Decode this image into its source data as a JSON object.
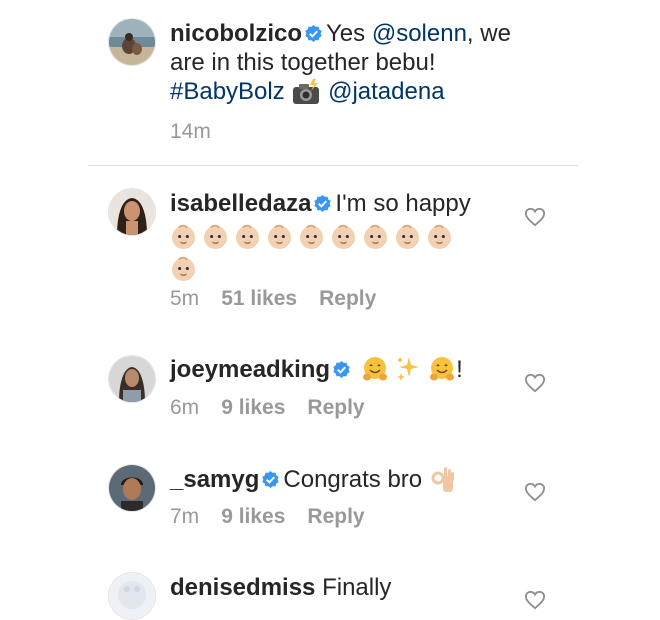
{
  "comments": [
    {
      "username": "nicobolzico",
      "verified": true,
      "text_before": "Yes ",
      "mention1": "@solenn",
      "text_mid": ", we are in this together bebu!",
      "hashtag": "#BabyBolz",
      "camera_emoji": "camera-with-flash",
      "mention2": "@jatadena",
      "time": "14m"
    },
    {
      "username": "isabelledaza",
      "verified": true,
      "text": "I'm so happy",
      "emoji": "baby-face",
      "emoji_count": 10,
      "time": "5m",
      "likes": "51 likes",
      "reply": "Reply"
    },
    {
      "username": "joeymeadking",
      "verified": true,
      "emoji": [
        "hugging-face",
        "sparkles",
        "hugging-face"
      ],
      "text_after": "!",
      "time": "6m",
      "likes": "9 likes",
      "reply": "Reply"
    },
    {
      "username": "_samyg",
      "verified": true,
      "text": "Congrats bro",
      "emoji": "ok-hand",
      "time": "7m",
      "likes": "9 likes",
      "reply": "Reply"
    },
    {
      "username": "denisedmiss",
      "verified": false,
      "text": "Finally"
    }
  ],
  "colors": {
    "text": "#262626",
    "muted": "#999999",
    "link": "#003569",
    "verified": "#3897f0"
  }
}
